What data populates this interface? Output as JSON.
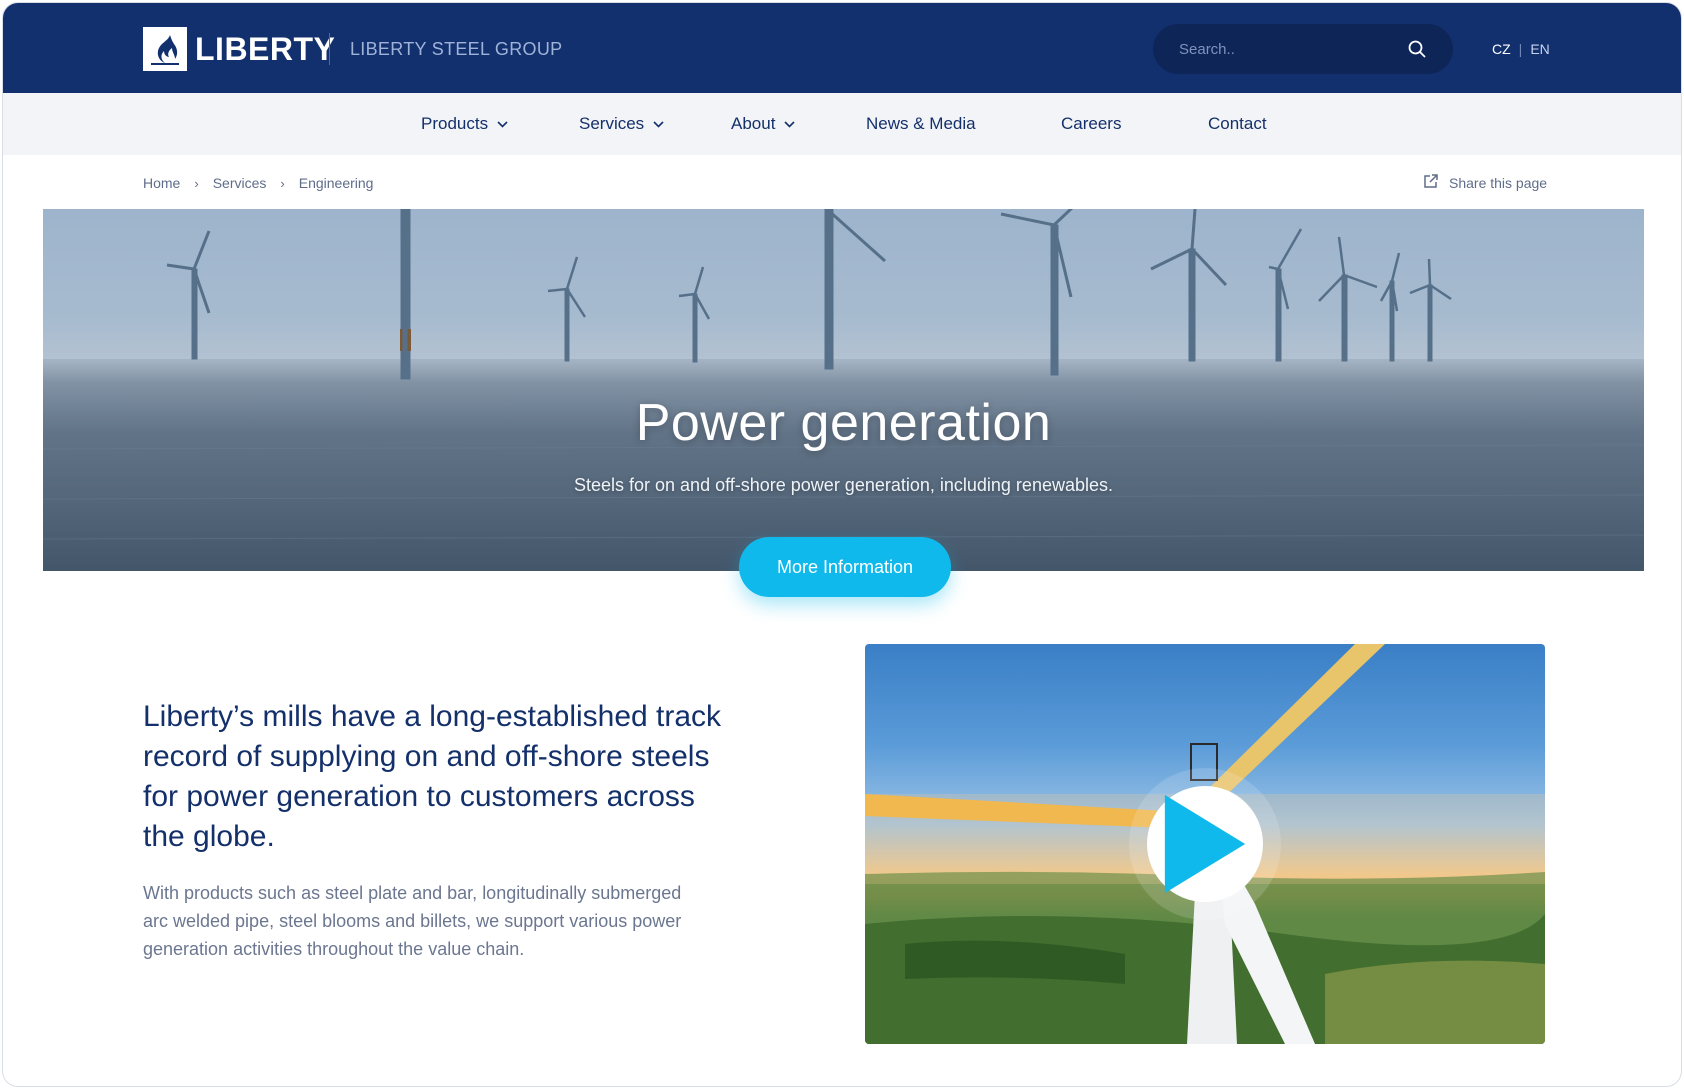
{
  "header": {
    "logo_text": "LIBERTY",
    "group_name": "LIBERTY STEEL GROUP",
    "search_placeholder": "Search..",
    "languages": [
      "CZ",
      "EN"
    ],
    "active_language": "CZ",
    "lang_separator": "|",
    "colors": {
      "header_bg": "#13306e",
      "accent": "#10b9ec"
    }
  },
  "nav": {
    "items": [
      {
        "label": "Products",
        "has_dropdown": true
      },
      {
        "label": "Services",
        "has_dropdown": true
      },
      {
        "label": "About",
        "has_dropdown": true
      },
      {
        "label": "News & Media",
        "has_dropdown": false
      },
      {
        "label": "Careers",
        "has_dropdown": false
      },
      {
        "label": "Contact",
        "has_dropdown": false
      }
    ]
  },
  "breadcrumb": {
    "items": [
      "Home",
      "Services",
      "Engineering"
    ],
    "separator": "›"
  },
  "share": {
    "label": "Share this page",
    "icon": "external-link-icon"
  },
  "hero": {
    "title": "Power generation",
    "subtitle": "Steels for on and off-shore power generation, including renewables.",
    "cta_label": "More Information"
  },
  "content": {
    "lead": "Liberty’s mills have a long-established track record of supplying on and off-shore steels for power generation to customers across the globe.",
    "body": "With products such as steel plate and bar, longitudinally submerged arc welded pipe, steel blooms and billets, we support various power generation activities throughout the value chain.",
    "video_icon": "play-icon"
  }
}
